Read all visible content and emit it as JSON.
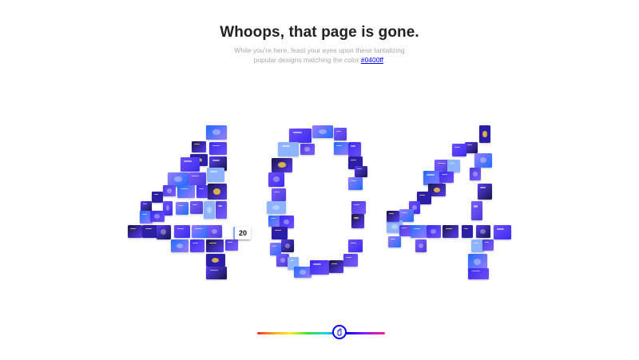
{
  "header": {
    "title": "Whoops, that page is gone.",
    "subtitle_line1": "While you're here, feast your eyes upon these tantalizing",
    "subtitle_line2_prefix": "popular designs matching the color ",
    "color_link": "#0400ff",
    "subtitle_suffix": "."
  },
  "mosaic": {
    "shape_text": "404",
    "tile_count": 96,
    "tile_palette": [
      "#3b2bf0",
      "#5b3cf5",
      "#7a5cff",
      "#1f6cff",
      "#2b1fa8",
      "#9b7cff",
      "#4c3bd9",
      "#16164a",
      "#6d4ff8",
      "#8fb4ff"
    ],
    "tile_sample_labels": [
      "20"
    ]
  },
  "color_slider": {
    "value": "#0400ff",
    "thumb_position_fraction": 0.64
  },
  "colors": {
    "accent": "#0400ff",
    "title": "#222222",
    "subtitle": "#a8a8ae"
  }
}
